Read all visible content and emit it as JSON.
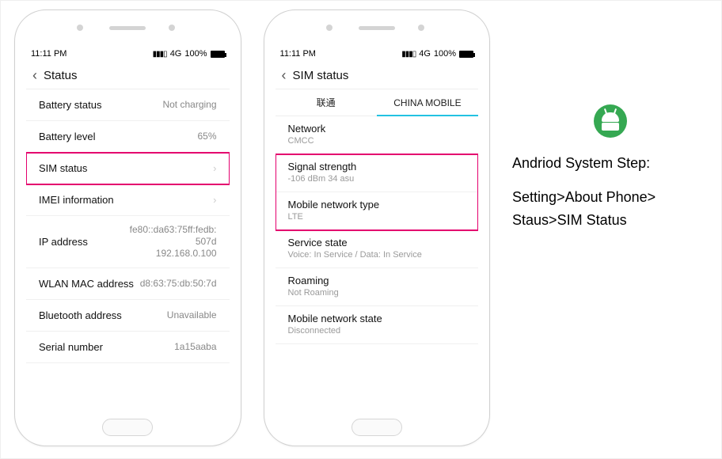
{
  "statusbar": {
    "time": "11:11 PM",
    "net": "4G",
    "batt": "100%"
  },
  "phone1": {
    "title": "Status",
    "rows": [
      {
        "label": "Battery status",
        "value": "Not charging"
      },
      {
        "label": "Battery level",
        "value": "65%"
      },
      {
        "label": "SIM status",
        "value": "",
        "chevron": true,
        "highlight": true
      },
      {
        "label": "IMEI information",
        "value": "",
        "chevron": true
      },
      {
        "label": "IP address",
        "value": "fe80::da63:75ff:fedb:\n507d\n192.168.0.100"
      },
      {
        "label": "WLAN MAC address",
        "value": "d8:63:75:db:50:7d"
      },
      {
        "label": "Bluetooth address",
        "value": "Unavailable"
      },
      {
        "label": "Serial number",
        "value": "1a15aaba"
      }
    ]
  },
  "phone2": {
    "title": "SIM  status",
    "tabs": [
      {
        "label": "联通",
        "active": false
      },
      {
        "label": "CHINA MOBILE",
        "active": true
      }
    ],
    "rows": [
      {
        "label": "Network",
        "sub": "CMCC"
      },
      {
        "label": "Signal strength",
        "sub": "-106 dBm 34 asu",
        "hl": "top"
      },
      {
        "label": "Mobile network type",
        "sub": "LTE",
        "hl": "bot"
      },
      {
        "label": "Service state",
        "sub": "Voice: In Service / Data: In Service"
      },
      {
        "label": "Roaming",
        "sub": "Not Roaming"
      },
      {
        "label": "Mobile network state",
        "sub": "Disconnected"
      }
    ]
  },
  "instruction": {
    "heading": "Andriod System Step:",
    "line1": "Setting>About Phone>",
    "line2": "Staus>SIM Status"
  }
}
